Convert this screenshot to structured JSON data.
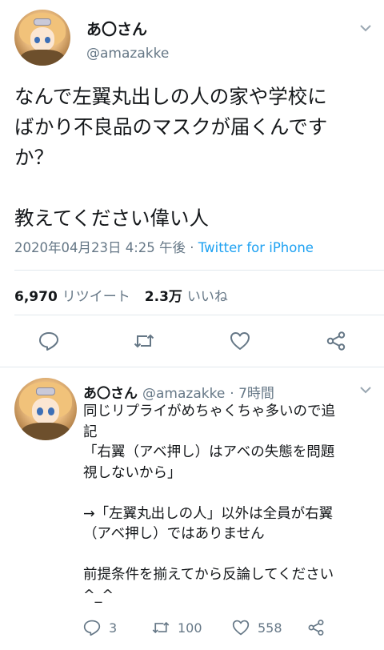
{
  "main_tweet": {
    "display_name": "あ〇さん",
    "handle": "@amazakke",
    "text_lines": [
      "なんで左翼丸出しの人の家や学校に",
      "ばかり不良品のマスクが届くんです",
      "か？",
      "教えてください偉い人"
    ],
    "timestamp": "2020年04月23日 4:25 午後",
    "separator": " · ",
    "source": "Twitter for iPhone",
    "retweet_count": "6,970",
    "retweet_label": "リツイート",
    "like_count": "2.3万",
    "like_label": "いいね"
  },
  "reply_tweet": {
    "display_name": "あ〇さん",
    "handle": "@amazakke",
    "time_ago": "· 7時間",
    "text_lines": [
      "同じリプライがめちゃくちゃ多いので追",
      "記",
      "「右翼（アベ押し）はアベの失態を問題",
      "視しないから」",
      "→「左翼丸出しの人」以外は全員が右翼",
      "（アベ押し）ではありません",
      "前提条件を揃えてから反論してください",
      "^_^"
    ],
    "reply_count": "3",
    "retweet_count": "100",
    "like_count": "558"
  },
  "icons": {
    "chevron": "chevron-down-icon",
    "reply": "reply-icon",
    "retweet": "retweet-icon",
    "like": "heart-icon",
    "share": "share-icon"
  },
  "colors": {
    "text": "#14171a",
    "secondary": "#657786",
    "link": "#1da1f2",
    "divider": "#e1e8ed"
  }
}
